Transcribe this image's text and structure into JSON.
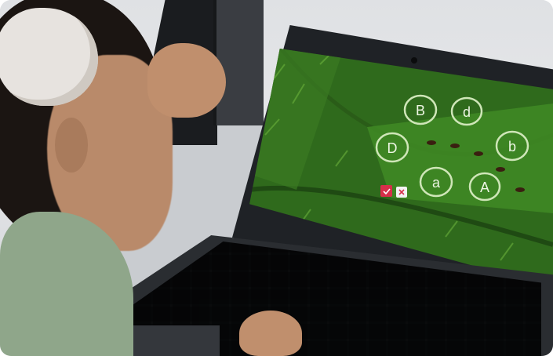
{
  "scene": {
    "description_free": true
  },
  "game": {
    "tiles": [
      {
        "letter": "B"
      },
      {
        "letter": "d"
      },
      {
        "letter": "D"
      },
      {
        "letter": "b"
      },
      {
        "letter": "a"
      },
      {
        "letter": "A"
      }
    ],
    "check_icon": "check-icon",
    "cancel_icon": "close-icon",
    "colors": {
      "leaf_dark": "#2f6a1c",
      "leaf_mid": "#3f8a25",
      "leaf_light": "#6bb13c",
      "button_red": "#d62f4a"
    }
  }
}
